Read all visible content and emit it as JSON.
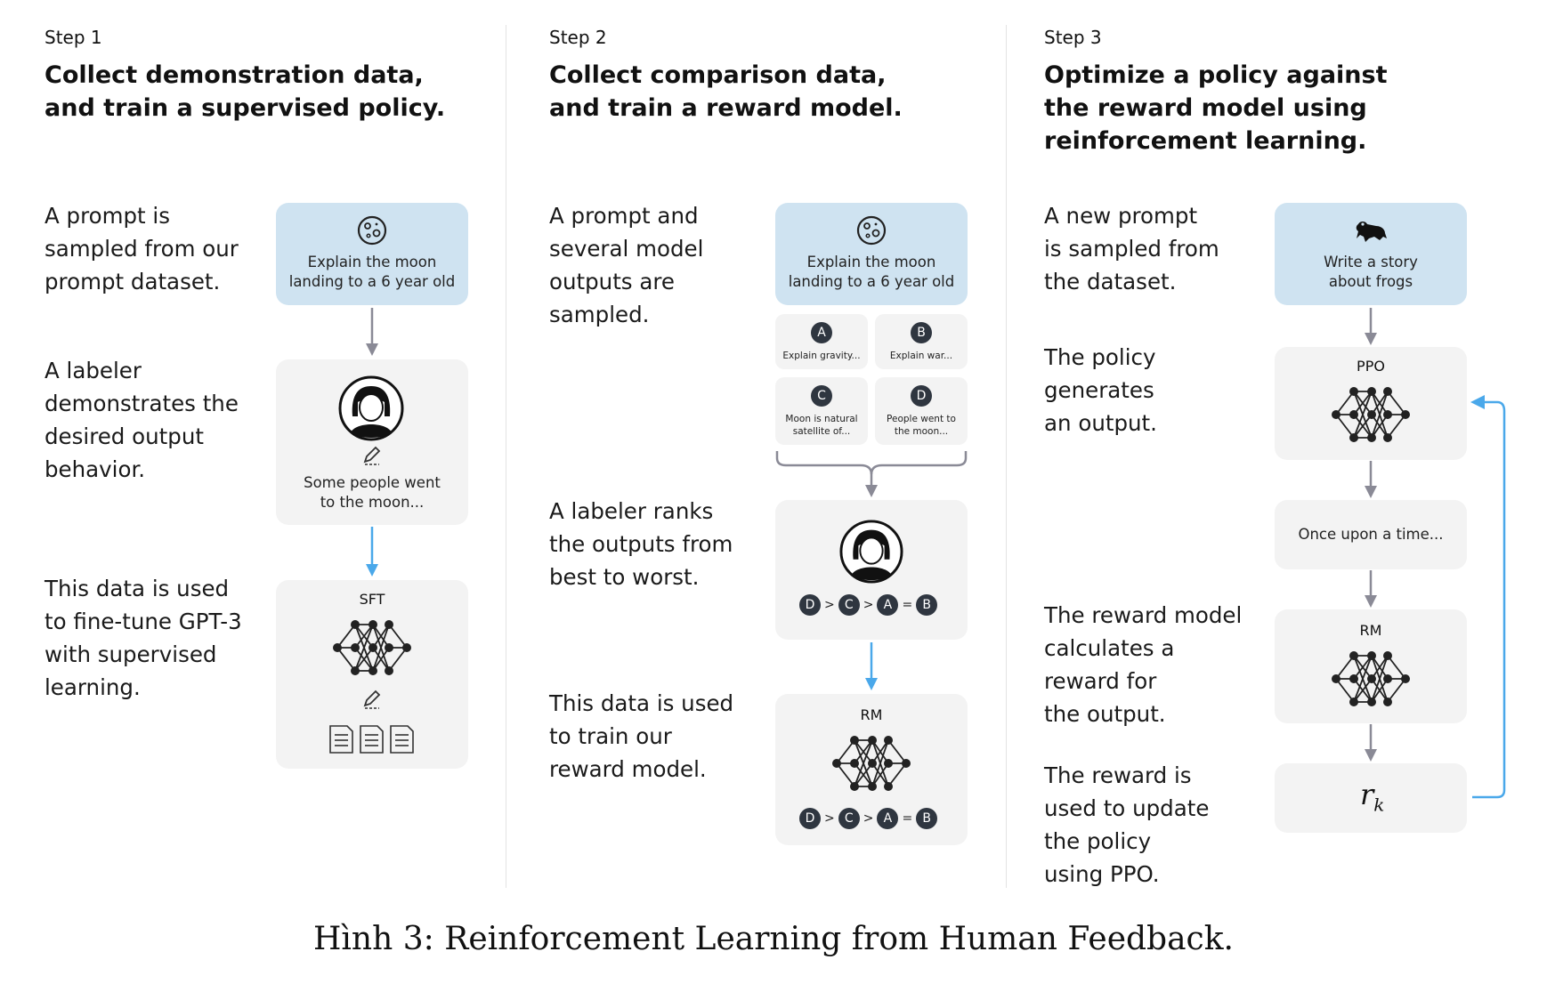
{
  "steps": [
    {
      "label": "Step 1",
      "title": [
        "Collect demonstration data,",
        "and train a supervised policy."
      ],
      "descs": [
        [
          "A prompt is",
          "sampled from our",
          "prompt dataset."
        ],
        [
          "A labeler",
          "demonstrates the",
          "desired output",
          "behavior."
        ],
        [
          "This data is used",
          "to fine-tune GPT-3",
          "with supervised",
          "learning."
        ]
      ],
      "prompt": [
        "Explain the moon",
        "landing to a 6 year old"
      ],
      "demo_text": [
        "Some people went",
        "to the moon..."
      ],
      "model": "SFT"
    },
    {
      "label": "Step 2",
      "title": [
        "Collect comparison data,",
        "and train a reward model."
      ],
      "descs": [
        [
          "A prompt and",
          "several model",
          "outputs are",
          "sampled."
        ],
        [
          "A labeler ranks",
          "the outputs from",
          "best to worst."
        ],
        [
          "This data is used",
          "to train our",
          "reward model."
        ]
      ],
      "prompt": [
        "Explain the moon",
        "landing to a 6 year old"
      ],
      "options": [
        {
          "letter": "A",
          "text": [
            "Explain gravity..."
          ]
        },
        {
          "letter": "B",
          "text": [
            "Explain war..."
          ]
        },
        {
          "letter": "C",
          "text": [
            "Moon is natural",
            "satellite of..."
          ]
        },
        {
          "letter": "D",
          "text": [
            "People went to",
            "the moon..."
          ]
        }
      ],
      "ranking": [
        "D",
        ">",
        "C",
        ">",
        "A",
        "=",
        "B"
      ],
      "model": "RM"
    },
    {
      "label": "Step 3",
      "title": [
        "Optimize a policy against",
        "the reward model using",
        "reinforcement learning."
      ],
      "descs": [
        [
          "A new prompt",
          "is sampled from",
          "the dataset."
        ],
        [
          "The policy",
          "generates",
          "an output."
        ],
        [
          "The reward model",
          "calculates a",
          "reward for",
          "the output."
        ],
        [
          "The reward is",
          "used to update",
          "the policy",
          "using PPO."
        ]
      ],
      "prompt": [
        "Write a story",
        "about frogs"
      ],
      "policy": "PPO",
      "output": "Once upon a time...",
      "reward_model": "RM",
      "reward_symbol": "r",
      "reward_subscript": "k"
    }
  ],
  "caption": "Hình 3: Reinforcement Learning from Human Feedback.",
  "colors": {
    "blue_box": "#cfe3f1",
    "gray_box": "#f3f3f3",
    "arrow_gray": "#8a8a96",
    "arrow_blue": "#4aa8ea"
  },
  "icons": [
    "moon-icon",
    "frog-icon",
    "labeler-avatar-icon",
    "pencil-icon",
    "neural-network-icon",
    "document-icon"
  ]
}
